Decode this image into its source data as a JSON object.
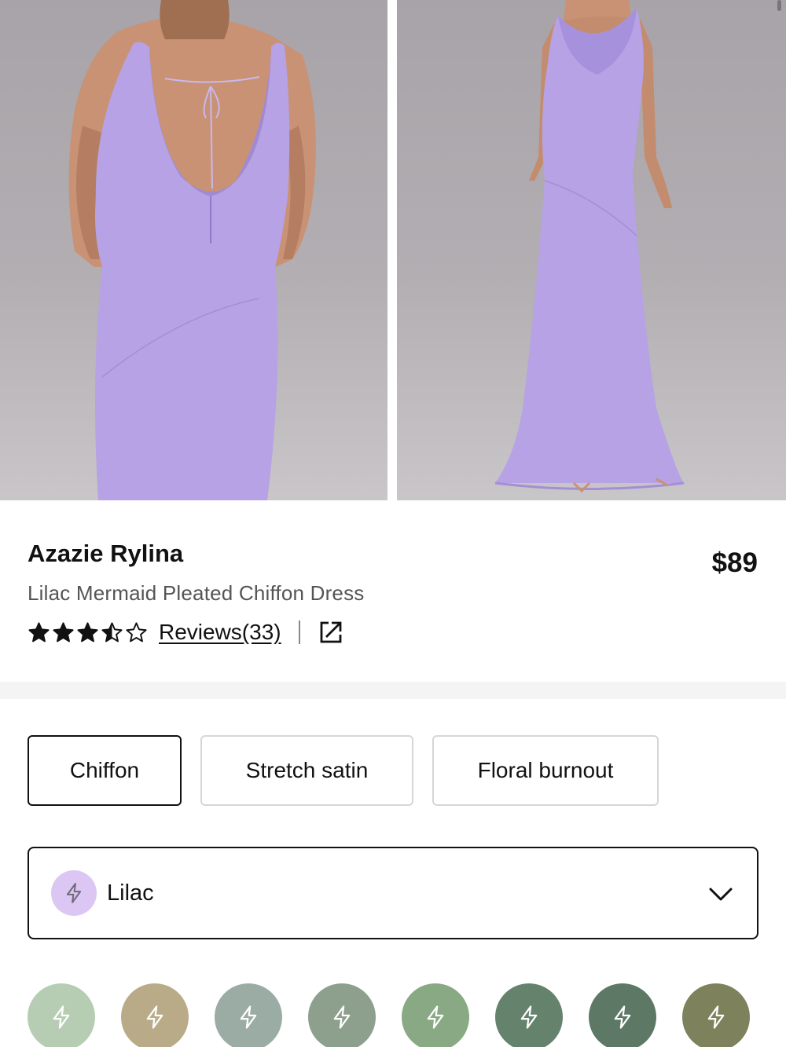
{
  "product": {
    "brand": "Azazie Rylina",
    "price": "$89",
    "subtitle": "Lilac Mermaid Pleated Chiffon Dress",
    "rating": 3.5,
    "rating_max": 5,
    "reviews_label": "Reviews(33)"
  },
  "gallery": {
    "images": [
      {
        "name": "back-view-photo",
        "icon": "photo"
      },
      {
        "name": "front-view-photo",
        "icon": "photo"
      }
    ]
  },
  "fabrics": {
    "options": [
      "Chiffon",
      "Stretch satin",
      "Floral burnout"
    ],
    "selected": "Chiffon"
  },
  "color_select": {
    "value": "Lilac",
    "swatch_color": "#dcc6f3",
    "icon": "lightning-icon",
    "chevron_icon": "chevron-down-icon"
  },
  "swatches": [
    {
      "color": "#b6cdb3"
    },
    {
      "color": "#b9ab88"
    },
    {
      "color": "#9aaca4"
    },
    {
      "color": "#8d9f8d"
    },
    {
      "color": "#89a884"
    },
    {
      "color": "#64826c"
    },
    {
      "color": "#5d7865"
    },
    {
      "color": "#7d815c"
    }
  ],
  "colors": {
    "dress": "#b6a2e4",
    "text_primary": "#111111",
    "text_secondary": "#555555",
    "border": "#d6d6d6"
  }
}
